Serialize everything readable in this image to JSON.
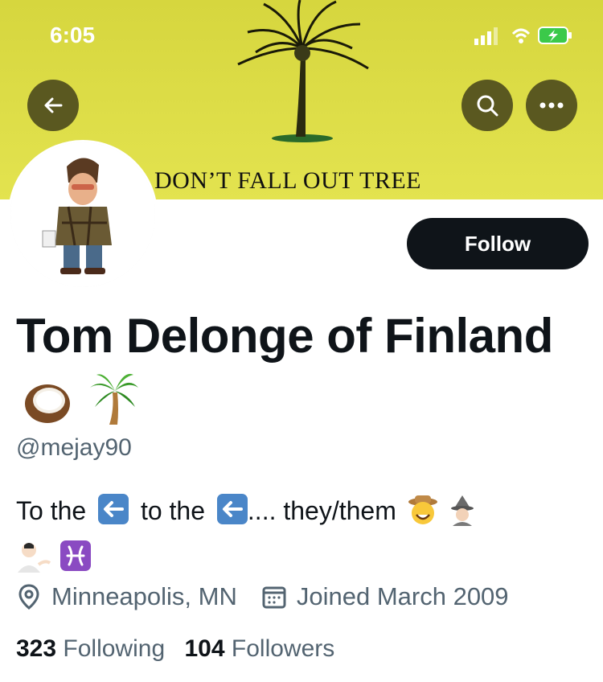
{
  "status": {
    "time": "6:05"
  },
  "banner": {
    "caption": "DON’T FALL OUT TREE",
    "color": "#dede4a"
  },
  "profile": {
    "follow_label": "Follow",
    "display_name": "Tom Delonge of Finland",
    "handle": "@mejay90",
    "bio_text_1": "To the",
    "bio_text_2": "to the",
    "bio_text_3": ".... they/them",
    "location": "Minneapolis, MN",
    "joined": "Joined March 2009",
    "following_count": "323",
    "following_label": "Following",
    "followers_count": "104",
    "followers_label": "Followers"
  },
  "icons": [
    "back-arrow-icon",
    "search-icon",
    "more-icon",
    "location-pin-icon",
    "calendar-icon",
    "coconut-emoji",
    "palm-tree-emoji"
  ],
  "colors": {
    "accent_dark": "#0f1419",
    "secondary_text": "#536471",
    "banner_button": "#5a5820"
  }
}
